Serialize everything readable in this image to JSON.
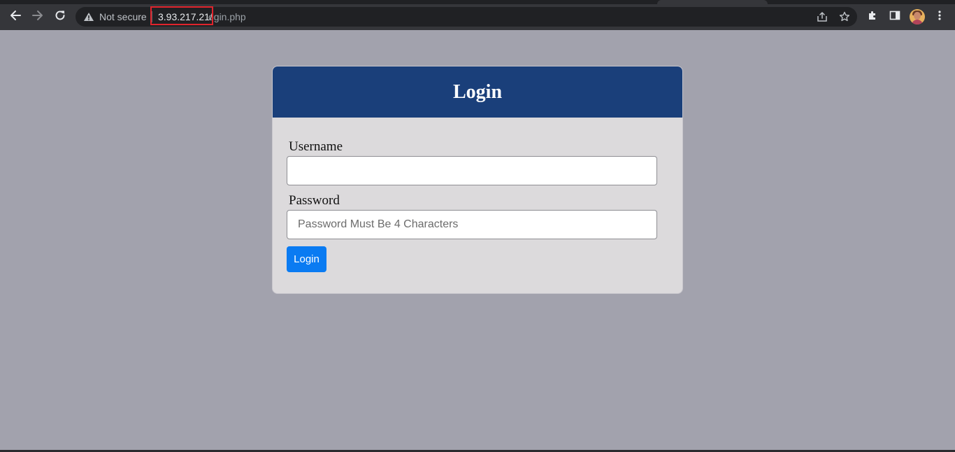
{
  "browser": {
    "security_label": "Not secure",
    "url_host": "3.93.217.21/",
    "url_path": "ogin.php",
    "icons": {
      "back": "back-arrow-icon",
      "forward": "forward-arrow-icon",
      "reload": "reload-icon",
      "warning": "warning-triangle-icon",
      "share": "share-icon",
      "bookmark": "star-icon",
      "extensions": "puzzle-icon",
      "side_panel": "side-panel-icon",
      "menu": "kebab-menu-icon"
    }
  },
  "login": {
    "title": "Login",
    "username_label": "Username",
    "username_value": "",
    "password_label": "Password",
    "password_placeholder": "Password Must Be 4 Characters",
    "submit_label": "Login"
  },
  "colors": {
    "page_background": "#a2a2ad",
    "header_background": "#1a3f7a",
    "card_background": "#dcdadc",
    "button_background": "#0a7bf2",
    "url_highlight": "#e0242c"
  }
}
